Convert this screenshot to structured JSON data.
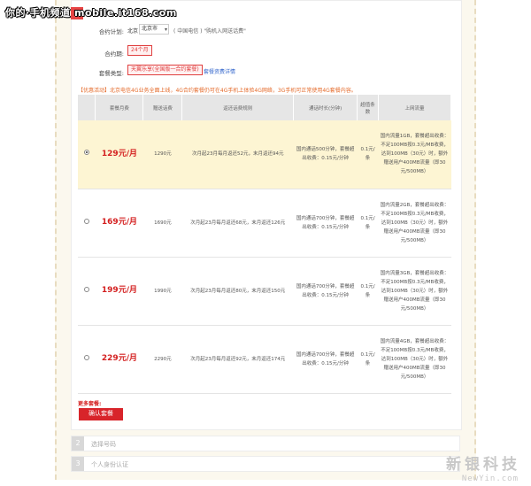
{
  "watermark": "你的·手机频道 mobile.it168.com",
  "step1": {
    "num": "1"
  },
  "plan_area": {
    "label": "合约计划:",
    "province": "北京",
    "city": "北京市",
    "operator_info": "( 中国电信 ) \"购机入网送话费\""
  },
  "contract_period": {
    "label": "合约期:",
    "value": "24个月"
  },
  "plan_type": {
    "label": "套餐类型:",
    "value": "天翼乐享(全国版一合约套餐)",
    "link": "套餐资费详情"
  },
  "promo": "【优惠活动】北京电信4G业务全面上线，4G合约套餐仍可在4G手机上体验4G网络，3G手机可正常使用4G套餐内容。",
  "table": {
    "headers": [
      "",
      "套餐月费",
      "赠送话费",
      "返还话费规则",
      "通话时长(分钟)",
      "超值条数",
      "上网流量"
    ],
    "rows": [
      {
        "selected": true,
        "price": "129",
        "unit": "元/月",
        "gift": "1290元",
        "rule": "次月起23月每月返还52元，末月返还94元",
        "call": "国内通话500分钟，套餐超出收费：0.15元/分钟",
        "sms": "0.1元/条",
        "data": "国内流量1GB，套餐超出收费：不足100MB按0.3元/MB收费，达到100MB（30元）时，额外赠送用户400MB流量（即30元/500MB）"
      },
      {
        "selected": false,
        "price": "169",
        "unit": "元/月",
        "gift": "1690元",
        "rule": "次月起23月每月返还68元，末月返还126元",
        "call": "国内通话700分钟，套餐超出收费：0.15元/分钟",
        "sms": "0.1元/条",
        "data": "国内流量2GB，套餐超出收费：不足100MB按0.3元/MB收费，达到100MB（30元）时，额外赠送用户400MB流量（即30元/500MB）"
      },
      {
        "selected": false,
        "price": "199",
        "unit": "元/月",
        "gift": "1990元",
        "rule": "次月起23月每月返还80元，末月返还150元",
        "call": "国内通话700分钟，套餐超出收费：0.15元/分钟",
        "sms": "0.1元/条",
        "data": "国内流量3GB，套餐超出收费：不足100MB按0.3元/MB收费，达到100MB（30元）时，额外赠送用户400MB流量（即30元/500MB）"
      },
      {
        "selected": false,
        "price": "229",
        "unit": "元/月",
        "gift": "2290元",
        "rule": "次月起23月每月返还92元，末月返还174元",
        "call": "国内通话700分钟，套餐超出收费：0.15元/分钟",
        "sms": "0.1元/条",
        "data": "国内流量4GB，套餐超出收费：不足100MB按0.3元/MB收费，达到100MB（30元）时，额外赠送用户400MB流量（即30元/500MB）"
      }
    ]
  },
  "more_label": "更多套餐:",
  "confirm_label": "确认套餐",
  "steps": [
    {
      "num": "2",
      "label": "选择号码"
    },
    {
      "num": "3",
      "label": "个人身份认证"
    }
  ],
  "corner_logo": "新银科技",
  "corner_url": "NewYin.com",
  "colors": {
    "accent_red": "#d8242a",
    "selected_row": "#fdf5d3",
    "link_blue": "#3366cc",
    "promo_orange": "#e46a2a"
  }
}
